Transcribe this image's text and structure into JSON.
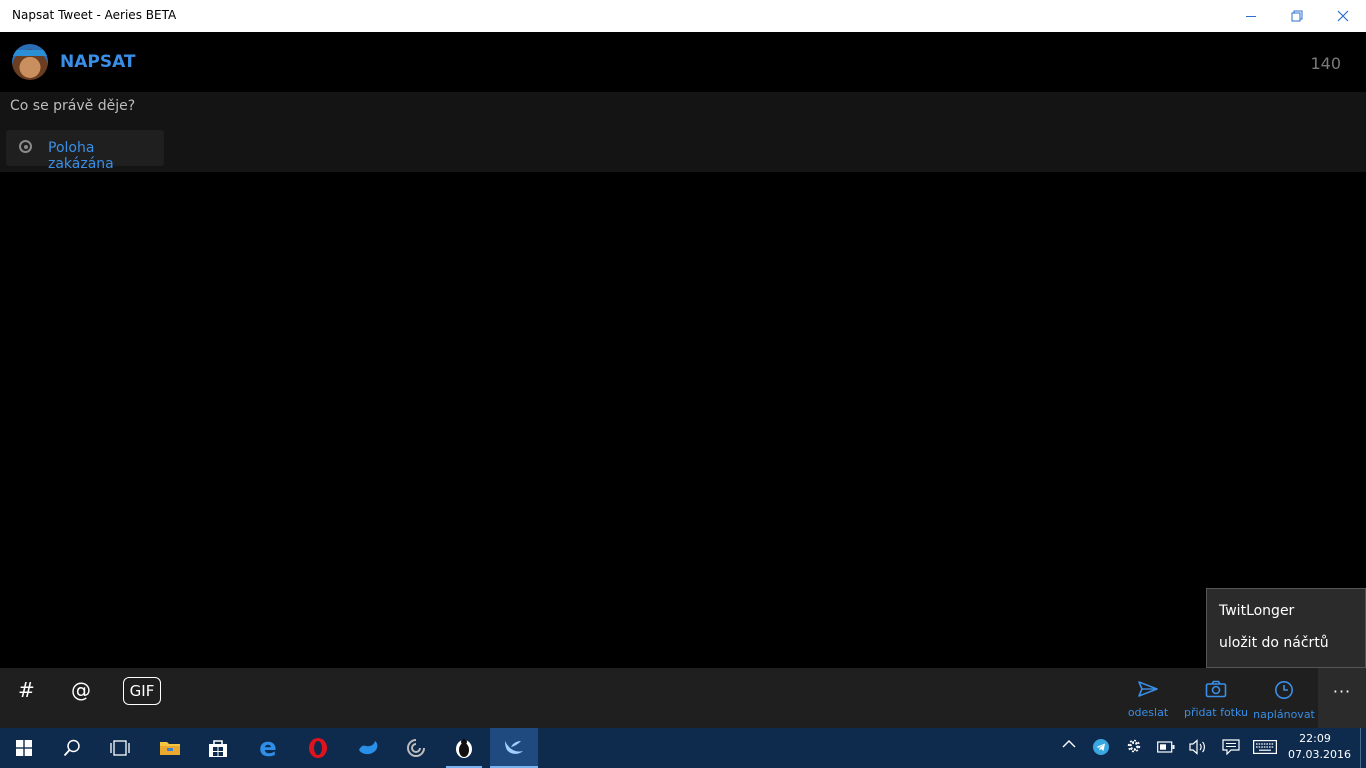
{
  "window": {
    "title": "Napsat Tweet - Aeries BETA"
  },
  "header": {
    "title": "NAPSAT",
    "char_count": "140"
  },
  "compose": {
    "placeholder": "Co se právě děje?",
    "location_label": "Poloha zakázána"
  },
  "menu": {
    "items": [
      "TwitLonger",
      "uložit do náčrtů"
    ]
  },
  "appbar": {
    "tools": {
      "hashtag": "#",
      "mention": "@",
      "gif": "GIF"
    },
    "actions": {
      "send": "odeslat",
      "add_photo": "přidat fotku",
      "schedule": "naplánovat"
    },
    "more": "···"
  },
  "taskbar": {
    "time": "22:09",
    "date": "07.03.2016",
    "apps": [
      "windows-start-icon",
      "search-icon",
      "task-view-icon",
      "file-explorer-icon",
      "store-icon",
      "edge-icon",
      "opera-icon",
      "bird-app-icon",
      "circle-app-icon",
      "penguin-app-icon",
      "aeries-app-icon"
    ]
  },
  "colors": {
    "accent": "#3a8ee6",
    "background": "#000000",
    "taskbar": "#0e2a4d"
  }
}
